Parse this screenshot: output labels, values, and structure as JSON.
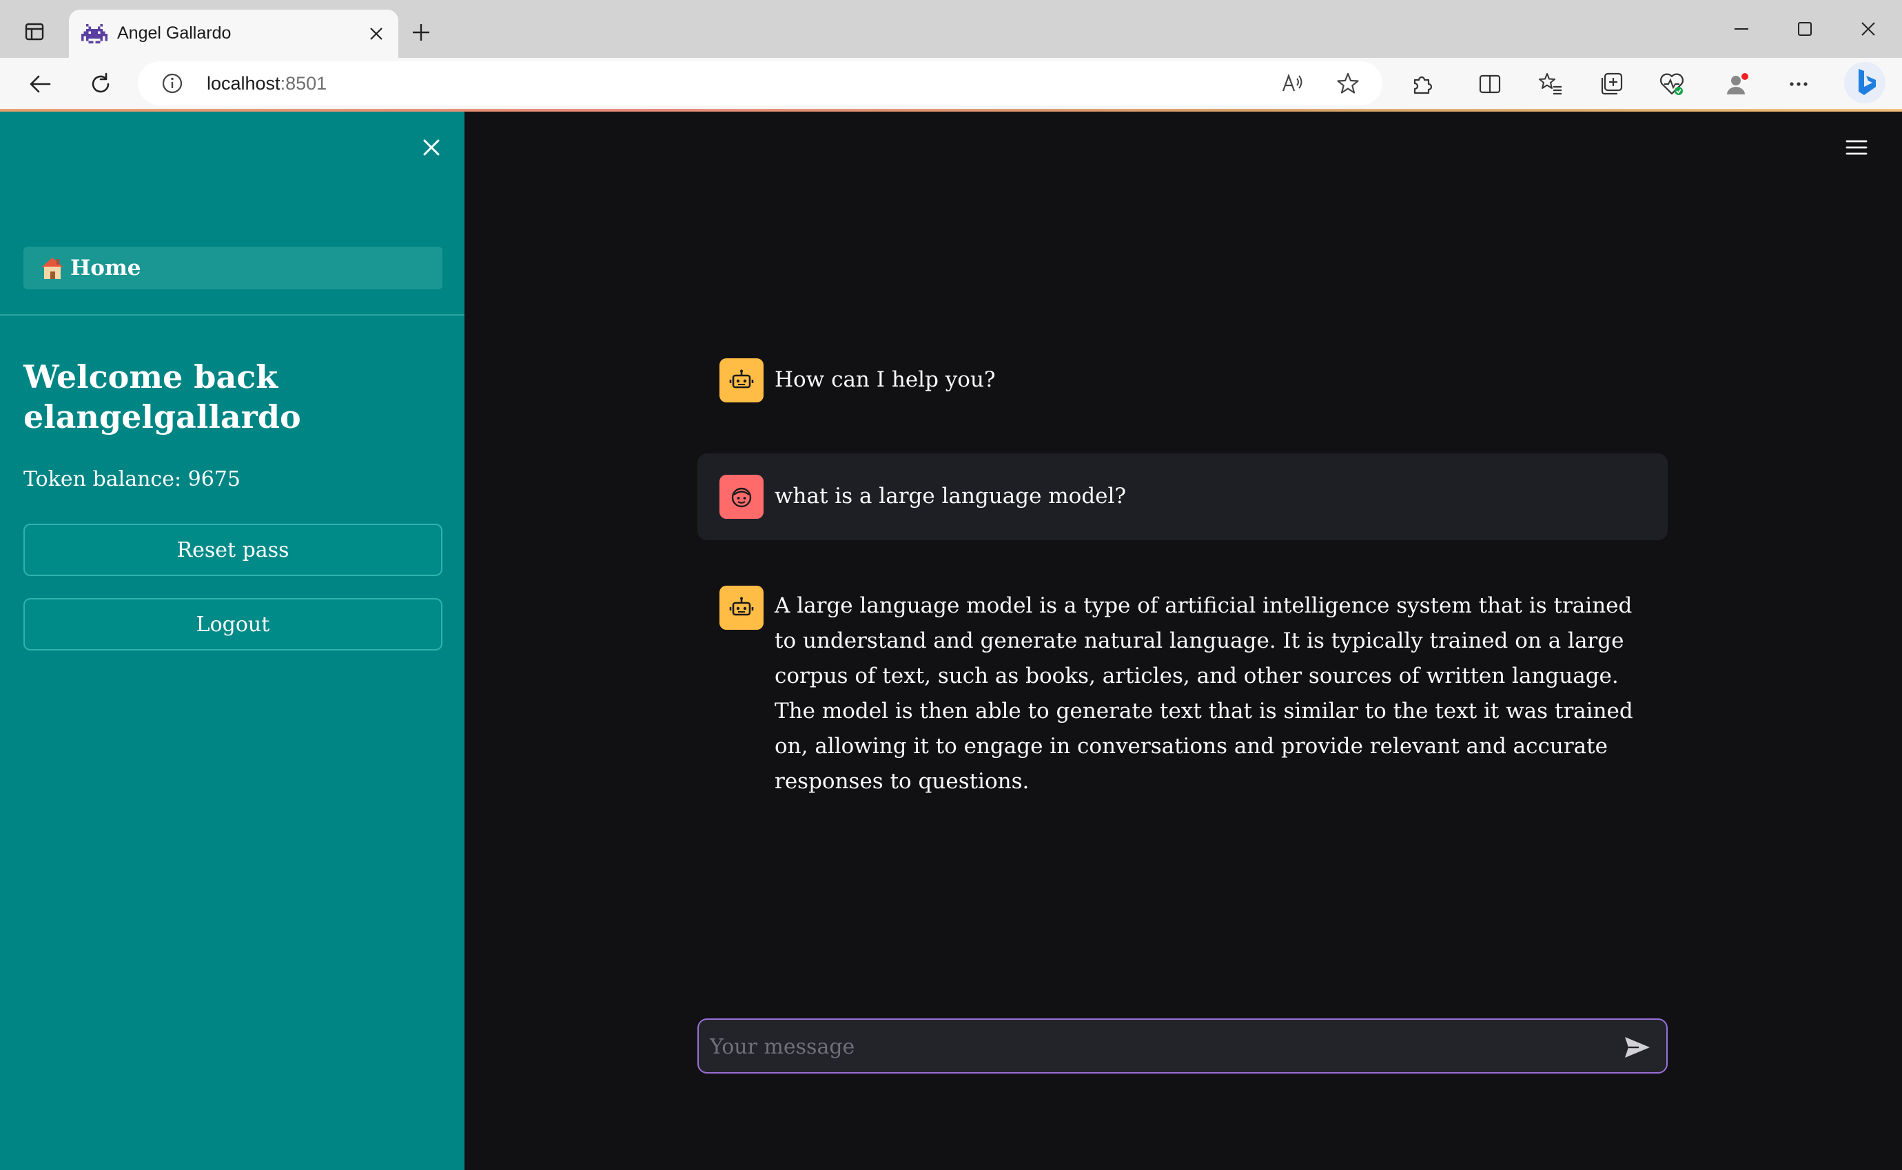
{
  "browser": {
    "tab_title": "Angel Gallardo",
    "url_host": "localhost",
    "url_port": ":8501"
  },
  "sidebar": {
    "nav_home_label": "Home",
    "welcome_heading": "Welcome back elangelgallardo",
    "token_balance": "Token balance: 9675",
    "reset_button": "Reset pass",
    "logout_button": "Logout"
  },
  "chat": {
    "messages": [
      {
        "role": "assistant",
        "text": "How can I help you?"
      },
      {
        "role": "user",
        "text": "what is a large language model?"
      },
      {
        "role": "assistant",
        "text": "A large language model is a type of artificial intelligence system that is trained to understand and generate natural language. It is typically trained on a large corpus of text, such as books, articles, and other sources of written language. The model is then able to generate text that is similar to the text it was trained on, allowing it to engage in conversations and provide relevant and accurate responses to questions."
      }
    ],
    "input_placeholder": "Your message"
  },
  "colors": {
    "sidebar_bg": "#008585",
    "main_bg": "#111114",
    "bot_avatar": "#ffbd45",
    "user_avatar": "#ff6b6b",
    "input_border": "#9a70d8"
  },
  "icons": {
    "tab_favicon": "space-invader-icon",
    "nav_home": "house-icon",
    "bot_avatar": "robot-icon",
    "user_avatar": "face-icon",
    "send": "send-arrow-icon"
  }
}
